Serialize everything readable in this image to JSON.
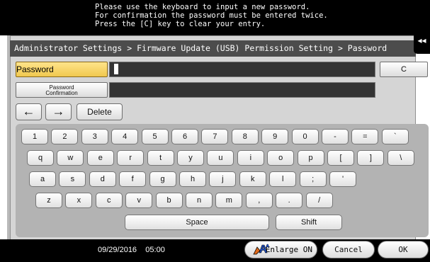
{
  "message": {
    "line1": "Please use the keyboard to input a new password.",
    "line2": "For confirmation the password must be entered twice.",
    "line3": "Press the [C] key to clear your entry."
  },
  "breadcrumb": "Administrator Settings > Firmware Update (USB) Permission Setting > Password",
  "side_tab_glyph": "◂◂",
  "fields": {
    "password_label": "Password",
    "confirm_line1": "Password",
    "confirm_line2": "Confirmation",
    "clear_label": "C"
  },
  "edit": {
    "left": "←",
    "right": "→",
    "delete": "Delete"
  },
  "keyboard": {
    "row1": [
      "1",
      "2",
      "3",
      "4",
      "5",
      "6",
      "7",
      "8",
      "9",
      "0",
      "-",
      "=",
      "`"
    ],
    "row2": [
      "q",
      "w",
      "e",
      "r",
      "t",
      "y",
      "u",
      "i",
      "o",
      "p",
      "[",
      "]",
      "\\"
    ],
    "row3": [
      "a",
      "s",
      "d",
      "f",
      "g",
      "h",
      "j",
      "k",
      "l",
      ";",
      "'"
    ],
    "row4": [
      "z",
      "x",
      "c",
      "v",
      "b",
      "n",
      "m",
      ",",
      ".",
      "/"
    ],
    "space": "Space",
    "shift": "Shift"
  },
  "footer": {
    "date": "09/29/2016",
    "time": "05:00",
    "enlarge": "Enlarge ON",
    "cancel": "Cancel",
    "ok": "OK"
  },
  "colors": {
    "accent_yellow": "#f0c84e",
    "enlarge_icon_orange": "#e06a1b",
    "enlarge_icon_blue": "#1e50c8"
  }
}
